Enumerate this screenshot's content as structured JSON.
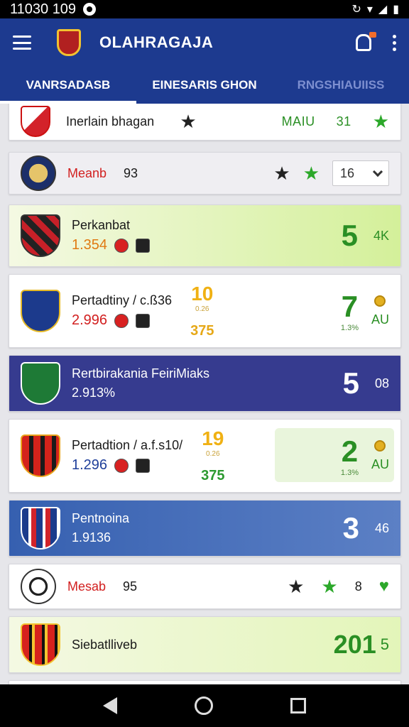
{
  "status_bar": {
    "time": "11030 109"
  },
  "app": {
    "title": "OLAHRAGAJA"
  },
  "tabs": [
    {
      "label": "VANRSADASB"
    },
    {
      "label": "EINESARIS GHON"
    },
    {
      "label": "RNGSHIAUIISS"
    }
  ],
  "rows": [
    {
      "name": "Inerlain bhagan",
      "middle_text": "MAIU",
      "right_num": "31"
    },
    {
      "name": "Meanb",
      "value": "93",
      "dropdown_value": "16"
    },
    {
      "name": "Perkanbat",
      "value": "1.354",
      "score": "5",
      "tag": "4K"
    },
    {
      "name": "Pertadtiny / c.ß36",
      "value": "2.996",
      "mid_top": "10",
      "mid_top_small": "0.26",
      "mid_bottom": "375",
      "score": "7",
      "score_pct": "1.3%",
      "tag": "AU"
    },
    {
      "name": "Rertbirakania FeiriMiaks",
      "value": "2.913%",
      "score": "5",
      "tag": "08"
    },
    {
      "name": "Pertadtion / a.f.s10/",
      "value": "1.296",
      "mid_top": "19",
      "mid_top_small": "0.26",
      "mid_bottom": "375",
      "score": "2",
      "score_pct": "1.3%",
      "tag": "AU"
    },
    {
      "name": "Pentnoina",
      "value": "1.9136",
      "score": "3",
      "tag": "46"
    },
    {
      "name": "Mesab",
      "value": "95",
      "right_num": "8"
    },
    {
      "name": "Siebatlliveb",
      "score": "201",
      "tag": "5"
    }
  ],
  "colors": {
    "primary": "#1d3a8f",
    "accent_green": "#2a8f24",
    "accent_gold": "#f0b114",
    "accent_red": "#d22020"
  }
}
